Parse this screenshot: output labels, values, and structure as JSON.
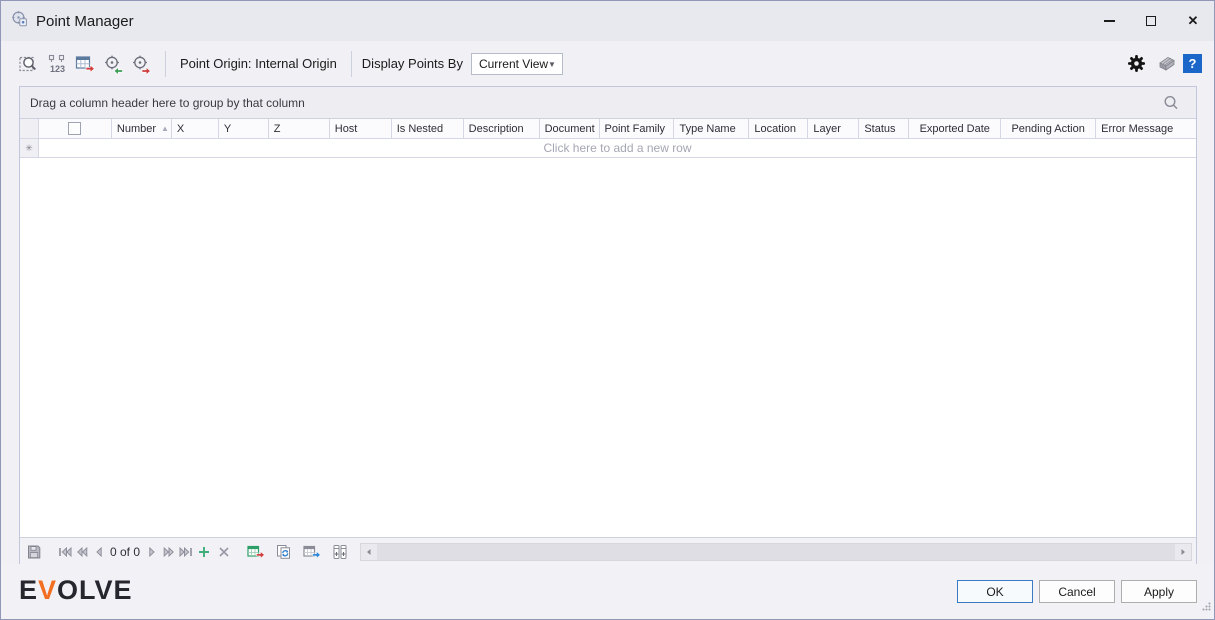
{
  "window": {
    "title": "Point Manager"
  },
  "toolbar": {
    "point_origin": "Point Origin: Internal Origin",
    "display_points_by_label": "Display Points By",
    "display_points_by_value": "Current View"
  },
  "group_panel": {
    "hint": "Drag a column header here to group by that column"
  },
  "grid": {
    "columns": [
      "Number",
      "X",
      "Y",
      "Z",
      "Host",
      "Is Nested",
      "Description",
      "Document",
      "Point Family",
      "Type Name",
      "Location",
      "Layer",
      "Status",
      "Exported Date",
      "Pending Action",
      "Error Message"
    ],
    "sort": {
      "column": "Number",
      "direction": "asc"
    },
    "new_row_hint": "Click here to add a new row"
  },
  "navigator": {
    "record_position": "0 of 0"
  },
  "footer": {
    "brand_e": "E",
    "brand_v": "V",
    "brand_olve": "OLVE",
    "ok_label": "OK",
    "cancel_label": "Cancel",
    "apply_label": "Apply"
  },
  "icons": {
    "sort_asc_glyph": "▲",
    "new_row_marker_glyph": "✳",
    "dropdown_chevron_glyph": "▼",
    "close_glyph": "✕",
    "help_glyph": "?"
  },
  "colors": {
    "help_blue": "#1b66c9",
    "brand_orange": "#f26f21",
    "ok_border_blue": "#3a79c3",
    "add_green": "#3fae7a",
    "export_red": "#cf3d3d"
  }
}
